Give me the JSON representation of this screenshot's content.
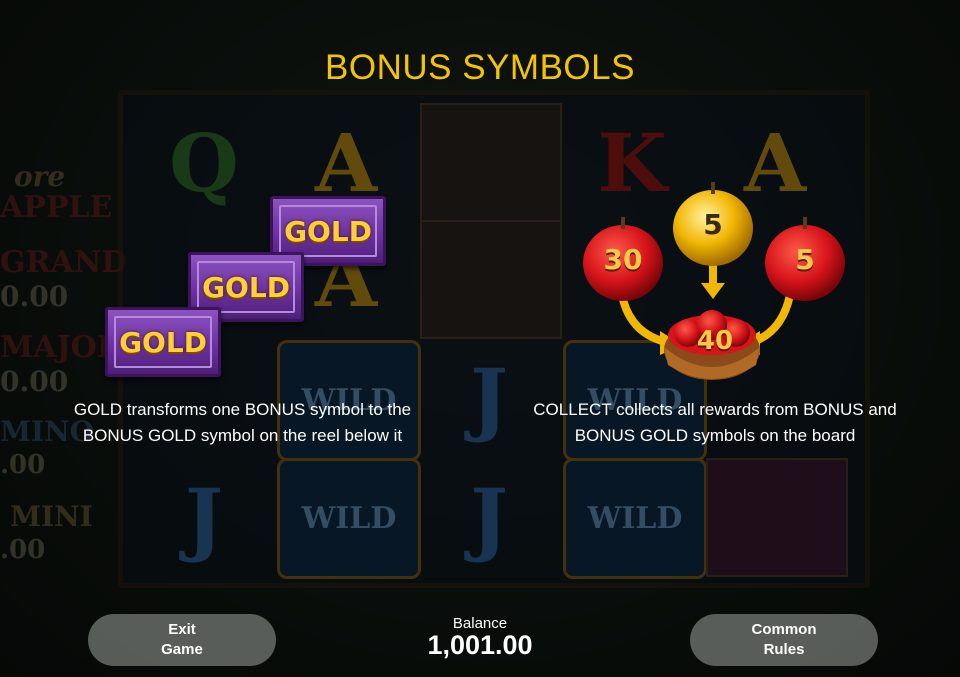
{
  "title": "BONUS SYMBOLS",
  "background": {
    "jackpot_partial_labels": [
      "ore",
      "APPLE",
      "GRAND",
      "0.00",
      "MAJOR",
      "0.00",
      "MINO",
      ".00",
      "MINI",
      ".00"
    ],
    "reel_symbols": [
      "Q",
      "A",
      "K",
      "A",
      "A",
      "J",
      "J",
      "J",
      "WILD",
      "WILD",
      "WILD",
      "WILD"
    ]
  },
  "gold_badges": [
    "GOLD",
    "GOLD",
    "GOLD"
  ],
  "gold_description": {
    "line1": "GOLD transforms one BONUS symbol to the",
    "line2": "BONUS GOLD symbol on the reel below it"
  },
  "collect_apples": {
    "red_left": "30",
    "golden_center": "5",
    "red_right": "5",
    "basket_total": "40"
  },
  "collect_description": {
    "line1": "COLLECT collects all rewards from BONUS and",
    "line2": "BONUS GOLD symbols on the board"
  },
  "buttons": {
    "exit_line1": "Exit",
    "exit_line2": "Game",
    "rules_line1": "Common",
    "rules_line2": "Rules"
  },
  "balance": {
    "label": "Balance",
    "value": "1,001.00"
  },
  "colors": {
    "title": "#f5c400",
    "gold_badge_purple": "#6a2f9e",
    "apple_red": "#d7141a",
    "apple_gold": "#f2b705"
  }
}
